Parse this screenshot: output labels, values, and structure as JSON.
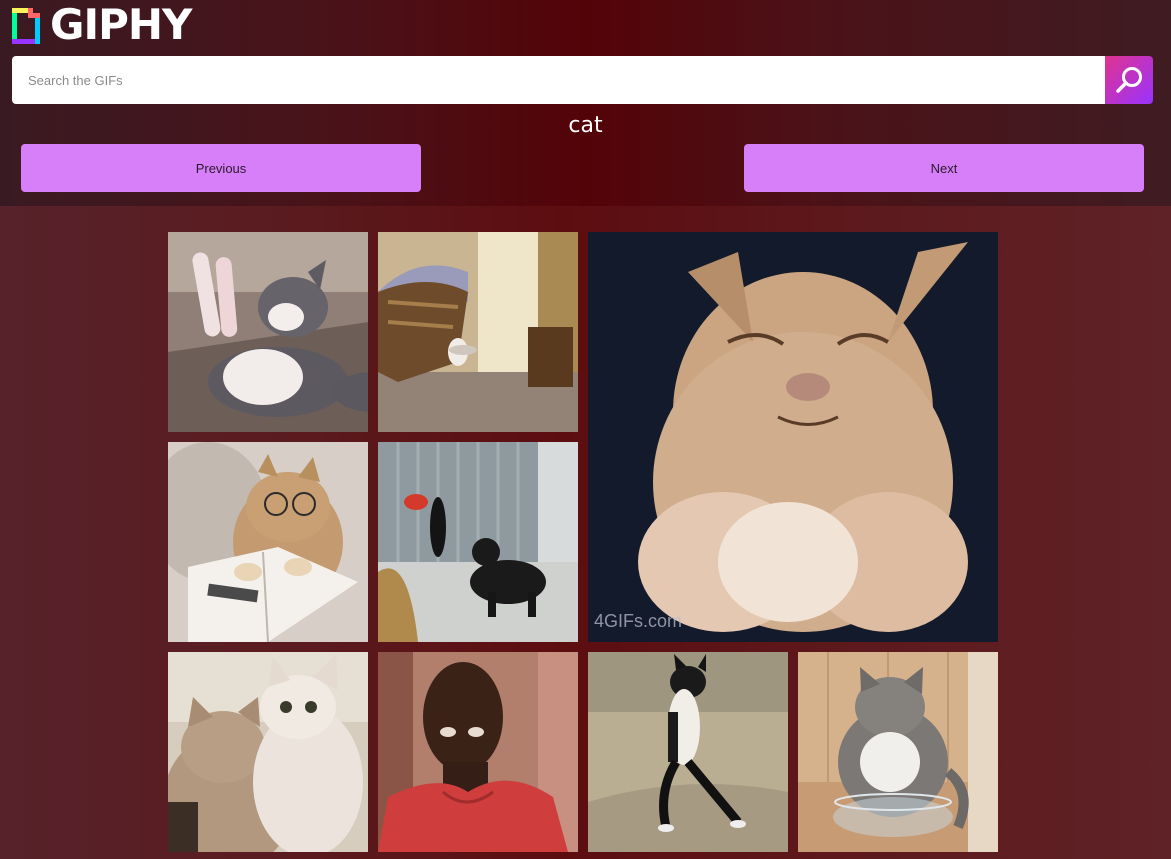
{
  "logo": {
    "text": "GIPHY"
  },
  "search": {
    "placeholder": "Search the GIFs",
    "value": ""
  },
  "query": "cat",
  "pagination": {
    "previous_label": "Previous",
    "next_label": "Next"
  },
  "results": [
    {
      "id": "gif-1",
      "watermark": ""
    },
    {
      "id": "gif-2",
      "watermark": ""
    },
    {
      "id": "gif-3",
      "watermark": "4GIFs.com"
    },
    {
      "id": "gif-4",
      "watermark": ""
    },
    {
      "id": "gif-5",
      "watermark": ""
    },
    {
      "id": "gif-6",
      "watermark": ""
    },
    {
      "id": "gif-7",
      "watermark": ""
    },
    {
      "id": "gif-8",
      "watermark": ""
    },
    {
      "id": "gif-9",
      "watermark": ""
    }
  ],
  "colors": {
    "accent_button": "#d77ff9",
    "search_button_start": "#e0338f",
    "search_button_end": "#9933ff"
  }
}
